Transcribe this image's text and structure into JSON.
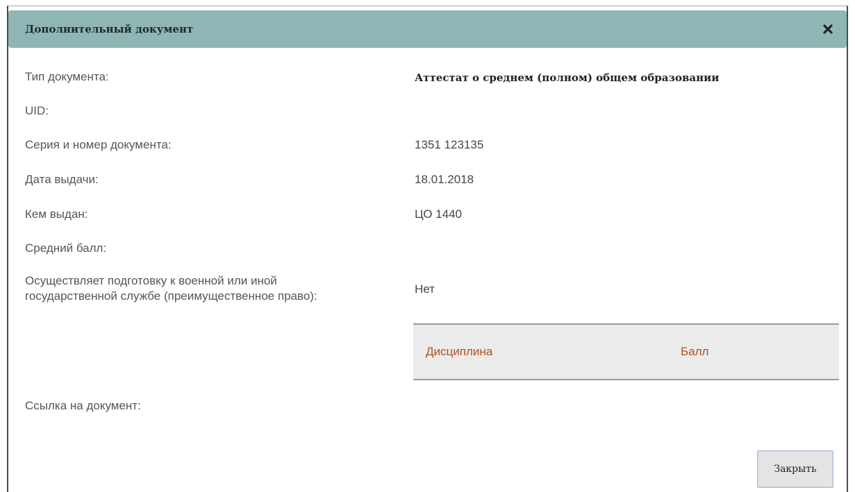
{
  "dialog": {
    "title": "Дополнительный документ",
    "close_icon": "close-icon"
  },
  "fields": {
    "doc_type_label": "Тип документа:",
    "doc_type_value": "Аттестат о среднем (полном) общем образовании",
    "uid_label": "UID:",
    "uid_value": "",
    "series_label": "Серия и номер документа:",
    "series_value": "1351 123135",
    "issue_date_label": "Дата выдачи:",
    "issue_date_value": "18.01.2018",
    "issued_by_label": "Кем выдан:",
    "issued_by_value": "ЦО 1440",
    "avg_score_label": "Средний балл:",
    "avg_score_value": "",
    "military_label_line1": "Осуществляет подготовку к военной или иной",
    "military_label_line2": "государственной службе (преимущественное право):",
    "military_value": "Нет",
    "link_label": "Ссылка на документ:",
    "link_value": ""
  },
  "grades_table": {
    "col_discipline": "Дисциплина",
    "col_score": "Балл",
    "header_color": "#b0501e"
  },
  "footer": {
    "close_label": "Закрыть"
  },
  "colors": {
    "titlebar": "#8fb5b5"
  }
}
